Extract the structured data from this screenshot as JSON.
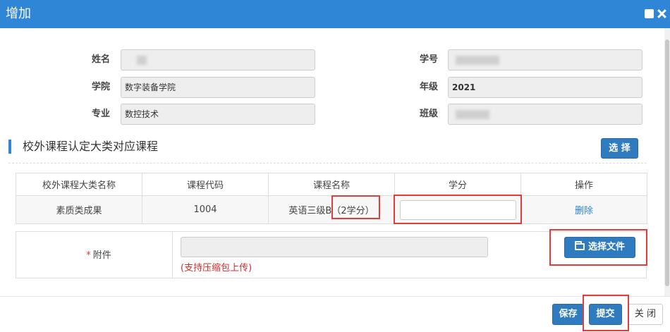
{
  "dialog": {
    "title": "增加"
  },
  "form": {
    "name_label": "姓名",
    "student_id_label": "学号",
    "college_label": "学院",
    "college_value": "数字装备学院",
    "grade_label": "年级",
    "grade_value": "2021",
    "major_label": "专业",
    "major_value": "数控技术",
    "class_label": "班级"
  },
  "section": {
    "title": "校外课程认定大类对应课程",
    "select_button": "选 择"
  },
  "table": {
    "headers": [
      "校外课程大类名称",
      "课程代码",
      "课程名称",
      "学分",
      "操作"
    ],
    "rows": [
      {
        "category": "素质类成果",
        "code": "1004",
        "course_name": "英语三级B",
        "credit_note": "（2学分）",
        "credit_value": "",
        "action": "删除"
      }
    ]
  },
  "attachment": {
    "required_mark": "*",
    "label": "附件",
    "hint": "(支持压缩包上传)",
    "choose_button": "选择文件"
  },
  "footer": {
    "save_button": "保存",
    "submit_button": "提交",
    "close_button": "关 闭"
  },
  "colors": {
    "titlebar": "#2f86d6",
    "primary_button": "#2f7bbf",
    "annotation_red": "#e23c3c",
    "hint_red": "#d92b2b"
  }
}
